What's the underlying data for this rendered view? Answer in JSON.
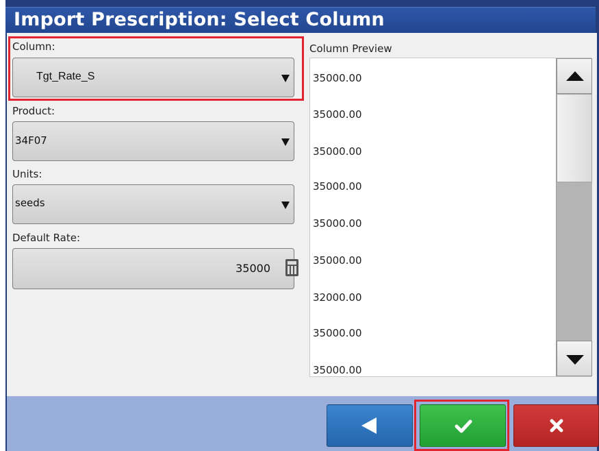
{
  "window": {
    "title": "Import Prescription: Select Column"
  },
  "form": {
    "column": {
      "label": "Column:",
      "value": "Tgt_Rate_S"
    },
    "product": {
      "label": "Product:",
      "value": "34F07"
    },
    "units": {
      "label": "Units:",
      "value": "seeds"
    },
    "default_rate": {
      "label": "Default Rate:",
      "value": "35000"
    }
  },
  "preview": {
    "label": "Column Preview",
    "items": [
      "35000.00",
      "35000.00",
      "35000.00",
      "35000.00",
      "35000.00",
      "35000.00",
      "32000.00",
      "35000.00",
      "35000.00"
    ]
  },
  "footer": {
    "buttons": [
      {
        "name": "back",
        "icon": "left-triangle-icon",
        "color": "#2f79c1"
      },
      {
        "name": "confirm",
        "icon": "checkmark-icon",
        "color": "#2bb33d"
      },
      {
        "name": "cancel",
        "icon": "x-icon",
        "color": "#c12f2f"
      }
    ]
  },
  "colors": {
    "title_bg": "#2b52a1",
    "highlight": "#e1242f",
    "footer_bg": "#9aaedc"
  }
}
